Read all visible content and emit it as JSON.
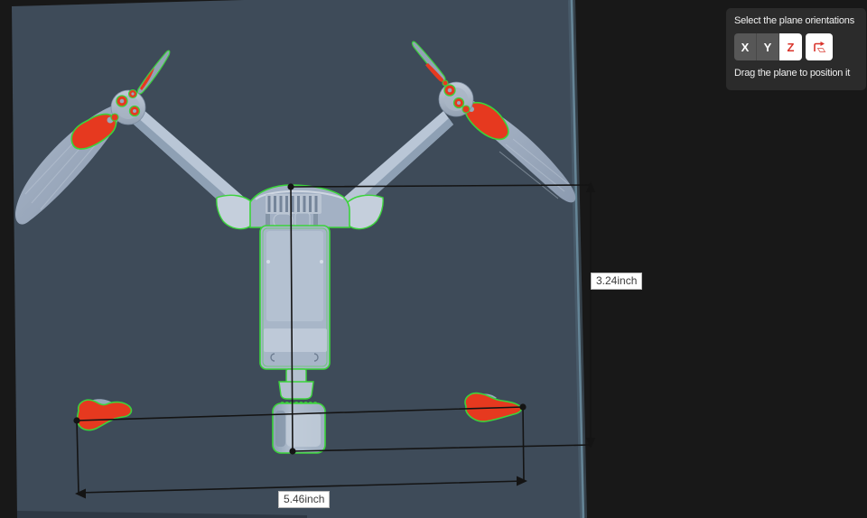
{
  "panel": {
    "title": "Select the plane orientations",
    "hint": "Drag the plane to position it",
    "buttons": [
      {
        "label": "X",
        "selected": false
      },
      {
        "label": "Y",
        "selected": false
      },
      {
        "label": "Z",
        "selected": true
      }
    ],
    "flip_button_icon": "flip-plane-icon"
  },
  "measurements": {
    "vertical": "3.24inch",
    "horizontal": "5.46inch"
  },
  "colors": {
    "background": "#181818",
    "plane": "#3e4b59",
    "plane_edge": "#6f93a6",
    "panel_bg": "#2b2b2b",
    "panel_text": "#f1f1f1",
    "button_dark": "#575757",
    "button_light": "#ffffff",
    "accent_red": "#d9342b",
    "outline_green": "#3bd43b",
    "section_red": "#e6391f",
    "model_gray": "#a9b7ca",
    "measure_line": "#141414",
    "label_bg": "#ffffff",
    "label_text": "#3c3c3c"
  }
}
